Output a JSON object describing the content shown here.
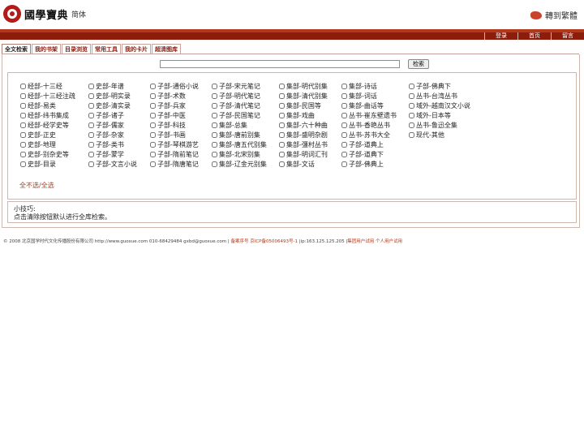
{
  "header": {
    "logo_text": "國學寶典",
    "logo_sub": "简体",
    "switch_label": "轉到繁體"
  },
  "nav": {
    "links": [
      "登录",
      "首页",
      "留言"
    ]
  },
  "tabs": [
    "全文检索",
    "我的书架",
    "目录浏览",
    "常用工具",
    "我的卡片",
    "超清图库"
  ],
  "search": {
    "value": "",
    "placeholder": "",
    "button_label": "检索"
  },
  "categories": [
    [
      "经部-十三经",
      "经部-十三经注疏",
      "经部-易类",
      "经部-纬书集成",
      "经部-经学史等",
      "史部-正史",
      "史部-地理",
      "史部-别杂史等",
      "史部-目录"
    ],
    [
      "史部-年谱",
      "史部-明实录",
      "史部-清实录",
      "子部-诸子",
      "子部-儒家",
      "子部-杂家",
      "子部-类书",
      "子部-蒙学",
      "子部-文言小说"
    ],
    [
      "子部-通俗小说",
      "子部-术数",
      "子部-兵家",
      "子部-中医",
      "子部-科技",
      "子部-书画",
      "子部-琴棋游艺",
      "子部-隋前笔记",
      "子部-隋唐笔记"
    ],
    [
      "子部-宋元笔记",
      "子部-明代笔记",
      "子部-清代笔记",
      "子部-民国笔记",
      "集部-总集",
      "集部-唐前别集",
      "集部-唐五代别集",
      "集部-北宋别集",
      "集部-辽金元别集"
    ],
    [
      "集部-明代别集",
      "集部-清代别集",
      "集部-民国等",
      "集部-戏曲",
      "集部-六十种曲",
      "集部-盛明杂剧",
      "集部-彊村丛书",
      "集部-明词汇刊",
      "集部-文话"
    ],
    [
      "集部-诗话",
      "集部-词话",
      "集部-曲话等",
      "丛书-崔东壁遗书",
      "丛书-香艳丛书",
      "丛书-苏书大全",
      "子部-道典上",
      "子部-道典下",
      "子部-佛典上"
    ],
    [
      "子部-佛典下",
      "丛书-台湾丛书",
      "域外-越南汉文小说",
      "域外-日本等",
      "丛书-鲁迅全集",
      "现代-其他"
    ]
  ],
  "select_all_label": "全不选/全选",
  "tip": {
    "title": "小技巧:",
    "text": "点击清除按钮默认进行全库检索。"
  },
  "footer": {
    "copyright": "© 2008 北京国学时代文化传播股份有限公司 http://www.guoxue.com 010-68429484 gxbd@guoxue.com |",
    "icp": " 备案序号 京ICP备05006493号-1",
    "ip": " |ip:163.125.125.205 |",
    "links": "集团用户试用 个人用户试用"
  },
  "colors": {
    "accent": "#b23a1a",
    "nav_bar": "#8c1d0c"
  }
}
